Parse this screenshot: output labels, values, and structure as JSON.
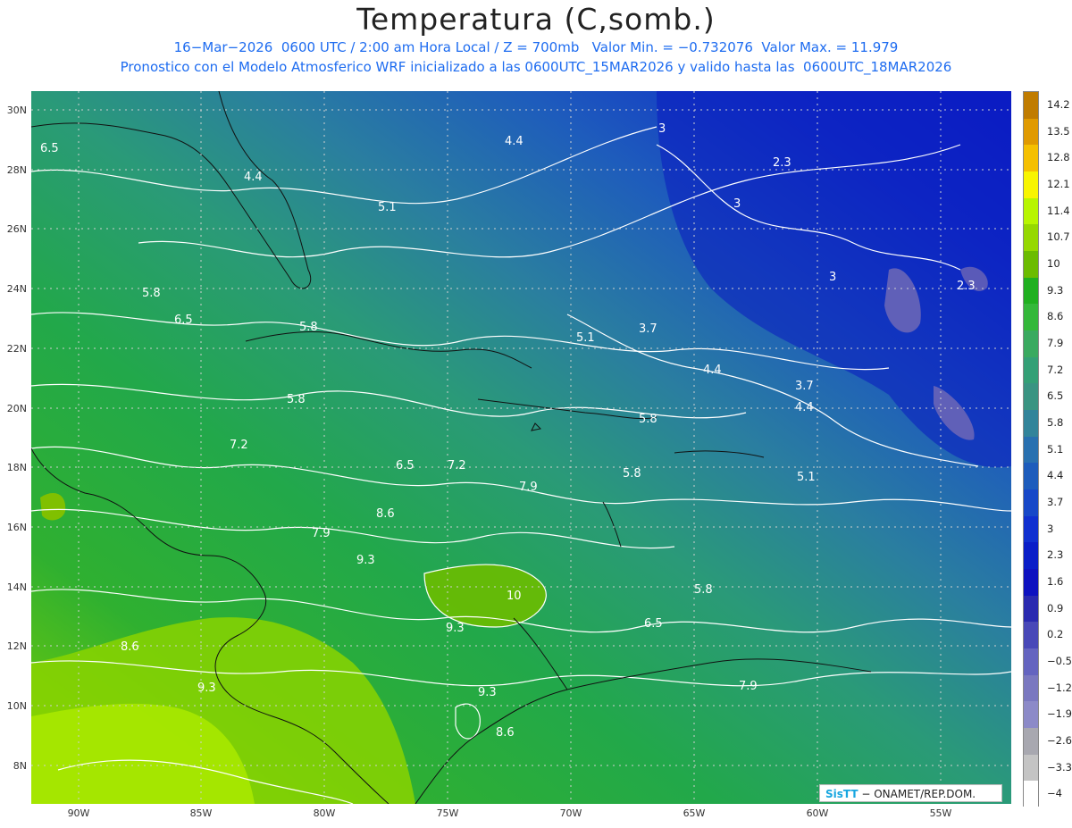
{
  "title": "Temperatura (C,somb.)",
  "subtitle_line1": "16−Mar−2026  0600 UTC / 2:00 am Hora Local / Z = 700mb   Valor Min. = −0.732076  Valor Max. = 11.979",
  "subtitle_line2": "Pronostico con el Modelo Atmosferico WRF inicializado a las 0600UTC_15MAR2026 y valido hasta las  0600UTC_18MAR2026",
  "lat_labels": [
    "30N",
    "28N",
    "26N",
    "24N",
    "22N",
    "20N",
    "18N",
    "16N",
    "14N",
    "12N",
    "10N",
    "8N"
  ],
  "lon_labels": [
    "90W",
    "85W",
    "80W",
    "75W",
    "70W",
    "65W",
    "60W",
    "55W"
  ],
  "colorbar_labels": [
    "14.2",
    "13.5",
    "12.8",
    "12.1",
    "11.4",
    "10.7",
    "10",
    "9.3",
    "8.6",
    "7.9",
    "7.2",
    "6.5",
    "5.8",
    "5.1",
    "4.4",
    "3.7",
    "3",
    "2.3",
    "1.6",
    "0.9",
    "0.2",
    "−0.5",
    "−1.2",
    "−1.9",
    "−2.6",
    "−3.3",
    "−4"
  ],
  "colorbar_colors": [
    "#c07c00",
    "#e09a00",
    "#f5c000",
    "#f8f500",
    "#b8f500",
    "#96d800",
    "#6cbc00",
    "#20b020",
    "#34b83a",
    "#3aaa60",
    "#34a076",
    "#3a9482",
    "#32849a",
    "#2870b0",
    "#1d5cbc",
    "#1748c8",
    "#1030d0",
    "#0a1ec8",
    "#0e12c0",
    "#2a2ab0",
    "#4848b8",
    "#6464c0",
    "#7a78c0",
    "#8c8ac8",
    "#a8a8b0",
    "#c4c4c4",
    "#ffffff"
  ],
  "contour_labels": [
    {
      "text": "6.5"
    },
    {
      "text": "4.4"
    },
    {
      "text": "4.4"
    },
    {
      "text": "5.1"
    },
    {
      "text": "3"
    },
    {
      "text": "2.3"
    },
    {
      "text": "3"
    },
    {
      "text": "5.8"
    },
    {
      "text": "6.5"
    },
    {
      "text": "5.8"
    },
    {
      "text": "5.1"
    },
    {
      "text": "3.7"
    },
    {
      "text": "3"
    },
    {
      "text": "2.3"
    },
    {
      "text": "4.4"
    },
    {
      "text": "3.7"
    },
    {
      "text": "5.8"
    },
    {
      "text": "4.4"
    },
    {
      "text": "5.8"
    },
    {
      "text": "7.2"
    },
    {
      "text": "6.5"
    },
    {
      "text": "7.2"
    },
    {
      "text": "5.8"
    },
    {
      "text": "5.1"
    },
    {
      "text": "7.9"
    },
    {
      "text": "8.6"
    },
    {
      "text": "7.9"
    },
    {
      "text": "9.3"
    },
    {
      "text": "10"
    },
    {
      "text": "5.8"
    },
    {
      "text": "9.3"
    },
    {
      "text": "6.5"
    },
    {
      "text": "8.6"
    },
    {
      "text": "9.3"
    },
    {
      "text": "9.3"
    },
    {
      "text": "7.9"
    },
    {
      "text": "8.6"
    }
  ],
  "credit": {
    "brand": "SisTT",
    "text": " −  ONAMET/REP.DOM."
  }
}
